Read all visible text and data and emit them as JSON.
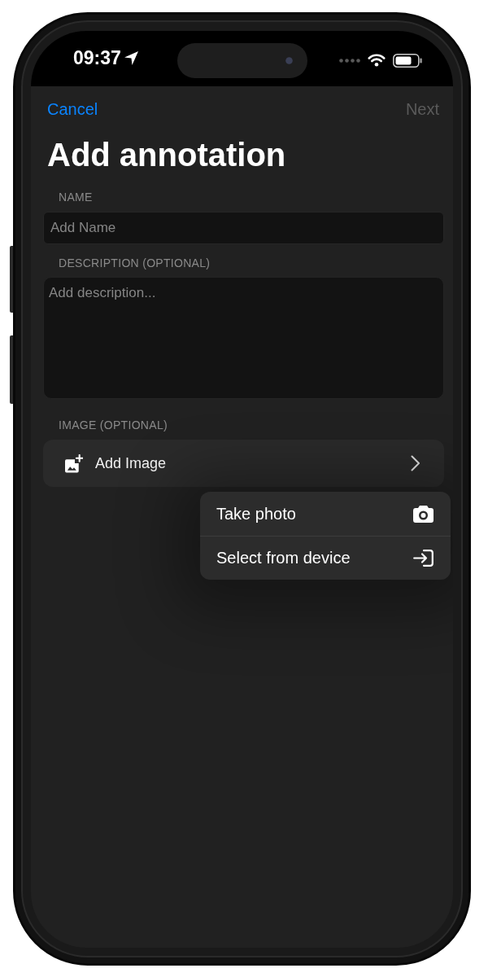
{
  "status_bar": {
    "time": "09:37"
  },
  "nav": {
    "cancel": "Cancel",
    "next": {
      "label": "Next",
      "disabled": true
    }
  },
  "title": "Add annotation",
  "form": {
    "name": {
      "label": "NAME",
      "placeholder": "Add Name"
    },
    "description": {
      "label": "DESCRIPTION (OPTIONAL)",
      "placeholder": "Add description..."
    },
    "image": {
      "label": "IMAGE (OPTIONAL)",
      "button": "Add Image"
    }
  },
  "menu": {
    "items": [
      {
        "label": "Take photo",
        "kind": "camera"
      },
      {
        "label": "Select from device",
        "kind": "import"
      }
    ]
  }
}
